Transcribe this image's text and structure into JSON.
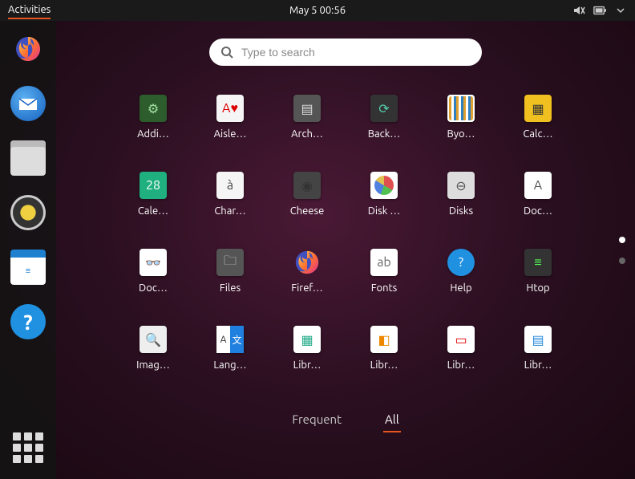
{
  "topbar": {
    "activities_label": "Activities",
    "datetime": "May 5  00:56"
  },
  "search": {
    "placeholder": "Type to search"
  },
  "dock": {
    "items": [
      {
        "name": "firefox",
        "icon": "firefox-icon"
      },
      {
        "name": "thunderbird",
        "icon": "thunderbird-icon"
      },
      {
        "name": "files",
        "icon": "files-icon"
      },
      {
        "name": "rhythmbox",
        "icon": "rhythmbox-icon"
      },
      {
        "name": "libreoffice-writer",
        "icon": "writer-icon"
      },
      {
        "name": "help",
        "icon": "help-icon"
      }
    ]
  },
  "apps": [
    {
      "label": "Addi…",
      "icon": "additional-drivers",
      "cls": "ico-additional",
      "glyph": "⚙"
    },
    {
      "label": "Aisle…",
      "icon": "aisleriot",
      "cls": "ico-aisle",
      "glyph": "A♥"
    },
    {
      "label": "Arch…",
      "icon": "archive-manager",
      "cls": "ico-archive",
      "glyph": "▤"
    },
    {
      "label": "Back…",
      "icon": "backups",
      "cls": "ico-backups",
      "glyph": "⟳"
    },
    {
      "label": "Byo…",
      "icon": "byobu",
      "cls": "ico-byobu",
      "glyph": ""
    },
    {
      "label": "Calc…",
      "icon": "calculator",
      "cls": "ico-calc",
      "glyph": "▦"
    },
    {
      "label": "Cale…",
      "icon": "calendar",
      "cls": "ico-calendar",
      "glyph": "28"
    },
    {
      "label": "Char…",
      "icon": "character-map",
      "cls": "ico-charmap",
      "glyph": "à"
    },
    {
      "label": "Cheese",
      "icon": "cheese",
      "cls": "ico-cheese",
      "glyph": "◉"
    },
    {
      "label": "Disk …",
      "icon": "disk-usage",
      "cls": "ico-diskusage",
      "glyph": ""
    },
    {
      "label": "Disks",
      "icon": "disks",
      "cls": "ico-disks",
      "glyph": "⊖"
    },
    {
      "label": "Doc…",
      "icon": "document-scanner",
      "cls": "ico-docscan",
      "glyph": "A"
    },
    {
      "label": "Doc…",
      "icon": "document-viewer",
      "cls": "ico-docviewer",
      "glyph": "👓"
    },
    {
      "label": "Files",
      "icon": "files",
      "cls": "ico-files",
      "glyph": "🗀"
    },
    {
      "label": "Firef…",
      "icon": "firefox",
      "cls": "ico-firefox",
      "glyph": ""
    },
    {
      "label": "Fonts",
      "icon": "fonts",
      "cls": "ico-fonts",
      "glyph": "ab"
    },
    {
      "label": "Help",
      "icon": "help",
      "cls": "ico-help",
      "glyph": "?"
    },
    {
      "label": "Htop",
      "icon": "htop",
      "cls": "ico-htop",
      "glyph": "≡"
    },
    {
      "label": "Imag…",
      "icon": "image-viewer",
      "cls": "ico-imgview",
      "glyph": "🔍"
    },
    {
      "label": "Lang…",
      "icon": "language-support",
      "cls": "ico-lang",
      "glyph": ""
    },
    {
      "label": "Libr…",
      "icon": "libreoffice-calc",
      "cls": "ico-lo1",
      "glyph": "▦"
    },
    {
      "label": "Libr…",
      "icon": "libreoffice-draw",
      "cls": "ico-lo2",
      "glyph": "◧"
    },
    {
      "label": "Libr…",
      "icon": "libreoffice-impress",
      "cls": "ico-lo3",
      "glyph": "▭"
    },
    {
      "label": "Libr…",
      "icon": "libreoffice-writer",
      "cls": "ico-lo4",
      "glyph": "▤"
    }
  ],
  "tabs": {
    "frequent": "Frequent",
    "all": "All",
    "active": "all"
  },
  "pager": {
    "pages": 2,
    "active": 0
  }
}
